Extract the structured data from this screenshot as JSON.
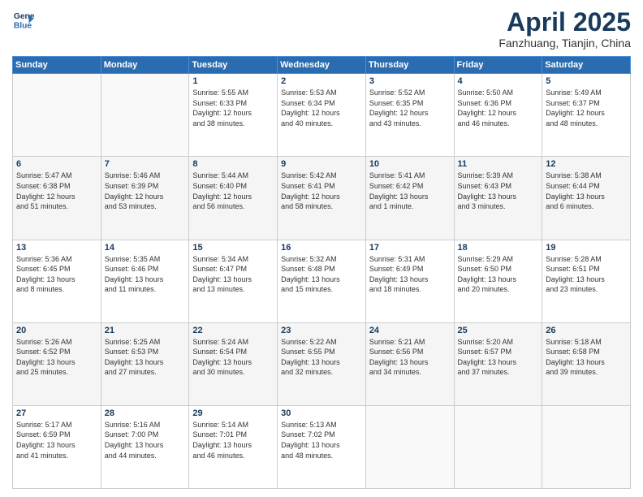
{
  "header": {
    "logo_line1": "General",
    "logo_line2": "Blue",
    "month": "April 2025",
    "location": "Fanzhuang, Tianjin, China"
  },
  "weekdays": [
    "Sunday",
    "Monday",
    "Tuesday",
    "Wednesday",
    "Thursday",
    "Friday",
    "Saturday"
  ],
  "weeks": [
    [
      {
        "day": "",
        "info": ""
      },
      {
        "day": "",
        "info": ""
      },
      {
        "day": "1",
        "info": "Sunrise: 5:55 AM\nSunset: 6:33 PM\nDaylight: 12 hours\nand 38 minutes."
      },
      {
        "day": "2",
        "info": "Sunrise: 5:53 AM\nSunset: 6:34 PM\nDaylight: 12 hours\nand 40 minutes."
      },
      {
        "day": "3",
        "info": "Sunrise: 5:52 AM\nSunset: 6:35 PM\nDaylight: 12 hours\nand 43 minutes."
      },
      {
        "day": "4",
        "info": "Sunrise: 5:50 AM\nSunset: 6:36 PM\nDaylight: 12 hours\nand 46 minutes."
      },
      {
        "day": "5",
        "info": "Sunrise: 5:49 AM\nSunset: 6:37 PM\nDaylight: 12 hours\nand 48 minutes."
      }
    ],
    [
      {
        "day": "6",
        "info": "Sunrise: 5:47 AM\nSunset: 6:38 PM\nDaylight: 12 hours\nand 51 minutes."
      },
      {
        "day": "7",
        "info": "Sunrise: 5:46 AM\nSunset: 6:39 PM\nDaylight: 12 hours\nand 53 minutes."
      },
      {
        "day": "8",
        "info": "Sunrise: 5:44 AM\nSunset: 6:40 PM\nDaylight: 12 hours\nand 56 minutes."
      },
      {
        "day": "9",
        "info": "Sunrise: 5:42 AM\nSunset: 6:41 PM\nDaylight: 12 hours\nand 58 minutes."
      },
      {
        "day": "10",
        "info": "Sunrise: 5:41 AM\nSunset: 6:42 PM\nDaylight: 13 hours\nand 1 minute."
      },
      {
        "day": "11",
        "info": "Sunrise: 5:39 AM\nSunset: 6:43 PM\nDaylight: 13 hours\nand 3 minutes."
      },
      {
        "day": "12",
        "info": "Sunrise: 5:38 AM\nSunset: 6:44 PM\nDaylight: 13 hours\nand 6 minutes."
      }
    ],
    [
      {
        "day": "13",
        "info": "Sunrise: 5:36 AM\nSunset: 6:45 PM\nDaylight: 13 hours\nand 8 minutes."
      },
      {
        "day": "14",
        "info": "Sunrise: 5:35 AM\nSunset: 6:46 PM\nDaylight: 13 hours\nand 11 minutes."
      },
      {
        "day": "15",
        "info": "Sunrise: 5:34 AM\nSunset: 6:47 PM\nDaylight: 13 hours\nand 13 minutes."
      },
      {
        "day": "16",
        "info": "Sunrise: 5:32 AM\nSunset: 6:48 PM\nDaylight: 13 hours\nand 15 minutes."
      },
      {
        "day": "17",
        "info": "Sunrise: 5:31 AM\nSunset: 6:49 PM\nDaylight: 13 hours\nand 18 minutes."
      },
      {
        "day": "18",
        "info": "Sunrise: 5:29 AM\nSunset: 6:50 PM\nDaylight: 13 hours\nand 20 minutes."
      },
      {
        "day": "19",
        "info": "Sunrise: 5:28 AM\nSunset: 6:51 PM\nDaylight: 13 hours\nand 23 minutes."
      }
    ],
    [
      {
        "day": "20",
        "info": "Sunrise: 5:26 AM\nSunset: 6:52 PM\nDaylight: 13 hours\nand 25 minutes."
      },
      {
        "day": "21",
        "info": "Sunrise: 5:25 AM\nSunset: 6:53 PM\nDaylight: 13 hours\nand 27 minutes."
      },
      {
        "day": "22",
        "info": "Sunrise: 5:24 AM\nSunset: 6:54 PM\nDaylight: 13 hours\nand 30 minutes."
      },
      {
        "day": "23",
        "info": "Sunrise: 5:22 AM\nSunset: 6:55 PM\nDaylight: 13 hours\nand 32 minutes."
      },
      {
        "day": "24",
        "info": "Sunrise: 5:21 AM\nSunset: 6:56 PM\nDaylight: 13 hours\nand 34 minutes."
      },
      {
        "day": "25",
        "info": "Sunrise: 5:20 AM\nSunset: 6:57 PM\nDaylight: 13 hours\nand 37 minutes."
      },
      {
        "day": "26",
        "info": "Sunrise: 5:18 AM\nSunset: 6:58 PM\nDaylight: 13 hours\nand 39 minutes."
      }
    ],
    [
      {
        "day": "27",
        "info": "Sunrise: 5:17 AM\nSunset: 6:59 PM\nDaylight: 13 hours\nand 41 minutes."
      },
      {
        "day": "28",
        "info": "Sunrise: 5:16 AM\nSunset: 7:00 PM\nDaylight: 13 hours\nand 44 minutes."
      },
      {
        "day": "29",
        "info": "Sunrise: 5:14 AM\nSunset: 7:01 PM\nDaylight: 13 hours\nand 46 minutes."
      },
      {
        "day": "30",
        "info": "Sunrise: 5:13 AM\nSunset: 7:02 PM\nDaylight: 13 hours\nand 48 minutes."
      },
      {
        "day": "",
        "info": ""
      },
      {
        "day": "",
        "info": ""
      },
      {
        "day": "",
        "info": ""
      }
    ]
  ]
}
